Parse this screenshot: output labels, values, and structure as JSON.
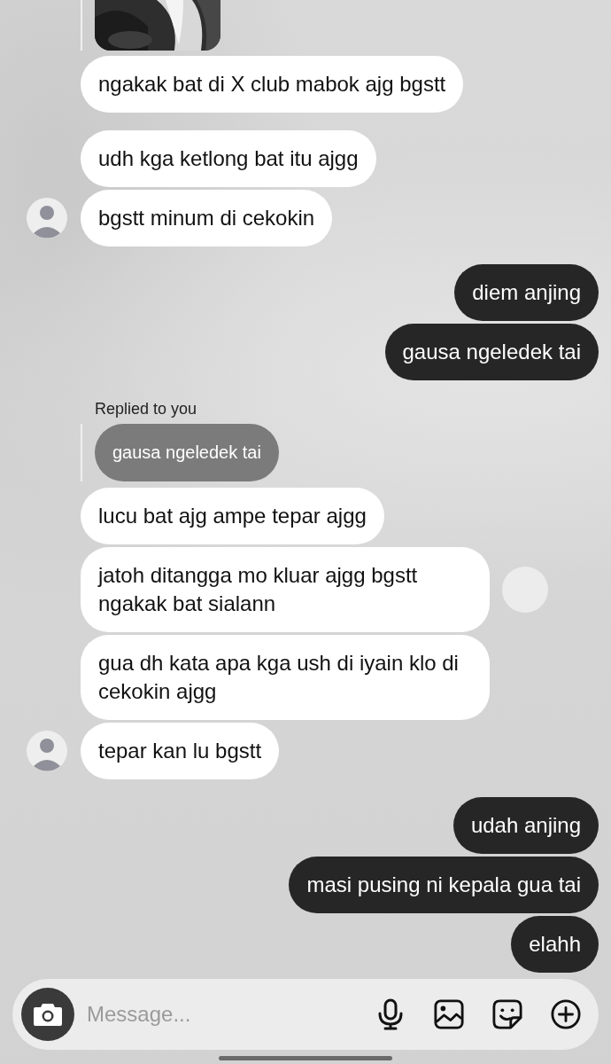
{
  "groups": [
    {
      "kind": "them",
      "avatar": false,
      "items": [
        {
          "kind": "quoted_picture"
        },
        {
          "kind": "text",
          "text": "ngakak bat di X club mabok ajg bgstt"
        }
      ]
    },
    {
      "kind": "them",
      "avatar": true,
      "items": [
        {
          "kind": "text",
          "text": "udh kga ketlong bat itu ajgg"
        },
        {
          "kind": "text",
          "text": "bgstt minum di cekokin"
        }
      ]
    },
    {
      "kind": "me",
      "avatar": false,
      "items": [
        {
          "kind": "text",
          "text": "diem anjing"
        },
        {
          "kind": "text",
          "text": "gausa ngeledek tai"
        }
      ]
    },
    {
      "kind": "them",
      "avatar": true,
      "items": [
        {
          "kind": "reply",
          "label": "Replied to you",
          "quoted": "gausa ngeledek tai"
        },
        {
          "kind": "text",
          "text": "lucu bat ajg ampe tepar ajgg"
        },
        {
          "kind": "text",
          "text": "jatoh ditangga mo kluar ajgg bgstt ngakak bat sialann",
          "side_button": true
        },
        {
          "kind": "text",
          "text": "gua dh kata apa kga ush di iyain klo di cekokin ajgg"
        },
        {
          "kind": "text",
          "text": "tepar kan lu bgstt"
        }
      ]
    },
    {
      "kind": "me",
      "avatar": false,
      "items": [
        {
          "kind": "text",
          "text": "udah anjing"
        },
        {
          "kind": "text",
          "text": "masi pusing ni kepala gua tai"
        },
        {
          "kind": "text",
          "text": "elahh"
        }
      ]
    }
  ],
  "composer": {
    "placeholder": "Message..."
  }
}
